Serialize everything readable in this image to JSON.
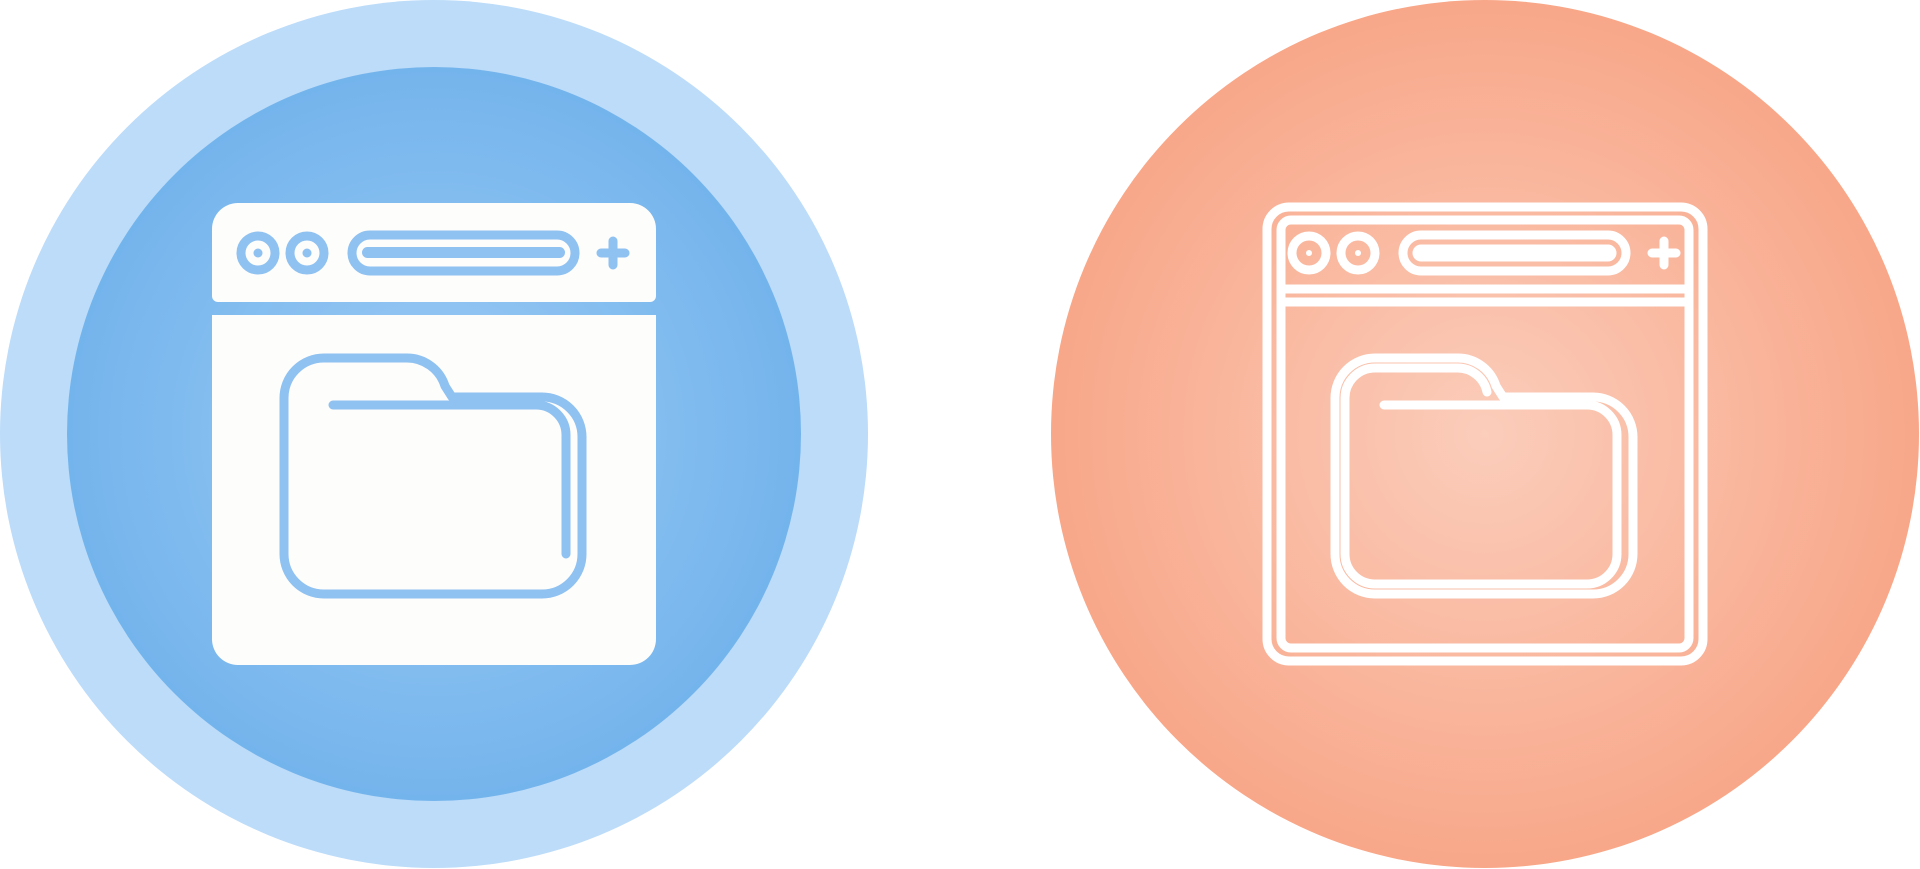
{
  "icons": [
    {
      "variant": "glyph",
      "icon": "browser-folder-icon",
      "colors": {
        "outer_ring": "#bcdcf9",
        "inner_circle_edge": "#74b4ec",
        "inner_circle_center": "#9ccbf5",
        "glyph_fill": "#fdfdfb",
        "glyph_cutout": "#8fc1f1"
      }
    },
    {
      "variant": "outline",
      "icon": "browser-folder-icon",
      "colors": {
        "circle_center": "#fbcdbb",
        "circle_edge": "#f8a789",
        "stroke": "#ffffff"
      }
    }
  ]
}
